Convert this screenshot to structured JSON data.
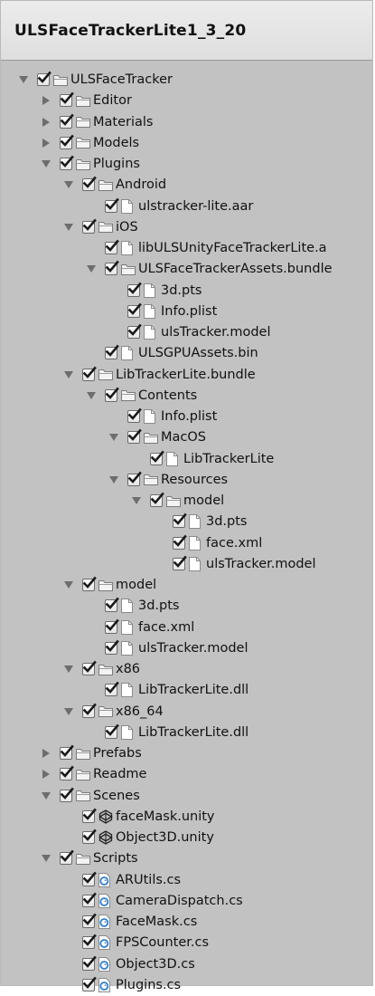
{
  "header": {
    "title": "ULSFaceTrackerLite1_3_20"
  },
  "tree": [
    {
      "label": "ULSFaceTracker",
      "depth": 0,
      "arrow": "open",
      "icon": "folder"
    },
    {
      "label": "Editor",
      "depth": 1,
      "arrow": "closed",
      "icon": "folder"
    },
    {
      "label": "Materials",
      "depth": 1,
      "arrow": "closed",
      "icon": "folder"
    },
    {
      "label": "Models",
      "depth": 1,
      "arrow": "closed",
      "icon": "folder"
    },
    {
      "label": "Plugins",
      "depth": 1,
      "arrow": "open",
      "icon": "folder"
    },
    {
      "label": "Android",
      "depth": 2,
      "arrow": "open",
      "icon": "folder"
    },
    {
      "label": "ulstracker-lite.aar",
      "depth": 3,
      "arrow": "none",
      "icon": "file"
    },
    {
      "label": "iOS",
      "depth": 2,
      "arrow": "open",
      "icon": "folder"
    },
    {
      "label": "libULSUnityFaceTrackerLite.a",
      "depth": 3,
      "arrow": "none",
      "icon": "file"
    },
    {
      "label": "ULSFaceTrackerAssets.bundle",
      "depth": 3,
      "arrow": "open",
      "icon": "folder"
    },
    {
      "label": "3d.pts",
      "depth": 4,
      "arrow": "none",
      "icon": "file"
    },
    {
      "label": "Info.plist",
      "depth": 4,
      "arrow": "none",
      "icon": "file"
    },
    {
      "label": "ulsTracker.model",
      "depth": 4,
      "arrow": "none",
      "icon": "file"
    },
    {
      "label": "ULSGPUAssets.bin",
      "depth": 3,
      "arrow": "none",
      "icon": "file"
    },
    {
      "label": "LibTrackerLite.bundle",
      "depth": 2,
      "arrow": "open",
      "icon": "folder"
    },
    {
      "label": "Contents",
      "depth": 3,
      "arrow": "open",
      "icon": "folder"
    },
    {
      "label": "Info.plist",
      "depth": 4,
      "arrow": "none",
      "icon": "file"
    },
    {
      "label": "MacOS",
      "depth": 4,
      "arrow": "open",
      "icon": "folder"
    },
    {
      "label": "LibTrackerLite",
      "depth": 5,
      "arrow": "none",
      "icon": "file"
    },
    {
      "label": "Resources",
      "depth": 4,
      "arrow": "open",
      "icon": "folder"
    },
    {
      "label": "model",
      "depth": 5,
      "arrow": "open",
      "icon": "folder"
    },
    {
      "label": "3d.pts",
      "depth": 6,
      "arrow": "none",
      "icon": "file"
    },
    {
      "label": "face.xml",
      "depth": 6,
      "arrow": "none",
      "icon": "file"
    },
    {
      "label": "ulsTracker.model",
      "depth": 6,
      "arrow": "none",
      "icon": "file"
    },
    {
      "label": "model",
      "depth": 2,
      "arrow": "open",
      "icon": "folder"
    },
    {
      "label": "3d.pts",
      "depth": 3,
      "arrow": "none",
      "icon": "file"
    },
    {
      "label": "face.xml",
      "depth": 3,
      "arrow": "none",
      "icon": "file"
    },
    {
      "label": "ulsTracker.model",
      "depth": 3,
      "arrow": "none",
      "icon": "file"
    },
    {
      "label": "x86",
      "depth": 2,
      "arrow": "open",
      "icon": "folder"
    },
    {
      "label": "LibTrackerLite.dll",
      "depth": 3,
      "arrow": "none",
      "icon": "file"
    },
    {
      "label": "x86_64",
      "depth": 2,
      "arrow": "open",
      "icon": "folder"
    },
    {
      "label": "LibTrackerLite.dll",
      "depth": 3,
      "arrow": "none",
      "icon": "file"
    },
    {
      "label": "Prefabs",
      "depth": 1,
      "arrow": "closed",
      "icon": "folder"
    },
    {
      "label": "Readme",
      "depth": 1,
      "arrow": "closed",
      "icon": "folder"
    },
    {
      "label": "Scenes",
      "depth": 1,
      "arrow": "open",
      "icon": "folder"
    },
    {
      "label": "faceMask.unity",
      "depth": 2,
      "arrow": "none",
      "icon": "unity"
    },
    {
      "label": "Object3D.unity",
      "depth": 2,
      "arrow": "none",
      "icon": "unity"
    },
    {
      "label": "Scripts",
      "depth": 1,
      "arrow": "open",
      "icon": "folder"
    },
    {
      "label": "ARUtils.cs",
      "depth": 2,
      "arrow": "none",
      "icon": "script"
    },
    {
      "label": "CameraDispatch.cs",
      "depth": 2,
      "arrow": "none",
      "icon": "script"
    },
    {
      "label": "FaceMask.cs",
      "depth": 2,
      "arrow": "none",
      "icon": "script"
    },
    {
      "label": "FPSCounter.cs",
      "depth": 2,
      "arrow": "none",
      "icon": "script"
    },
    {
      "label": "Object3D.cs",
      "depth": 2,
      "arrow": "none",
      "icon": "script"
    },
    {
      "label": "Plugins.cs",
      "depth": 2,
      "arrow": "none",
      "icon": "script"
    }
  ],
  "colors": {
    "check": "#1a1a1a",
    "folder": "#f3f3f3",
    "script": "#2f7fd0"
  }
}
